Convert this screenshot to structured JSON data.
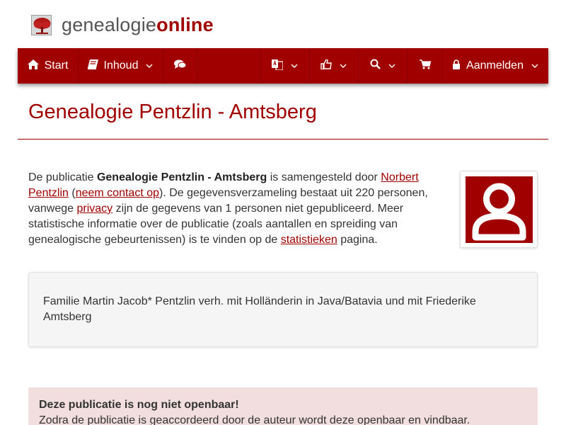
{
  "logo": {
    "text_part1": "genealogie",
    "text_part2": "online",
    "icon": "tree-icon"
  },
  "nav": {
    "start_label": "Start",
    "start_icon": "home-icon",
    "inhoud_label": "Inhoud",
    "inhoud_icon": "book-icon",
    "forum_icon": "comments-icon",
    "language_icon": "translate-icon",
    "like_icon": "thumbs-up-icon",
    "search_icon": "search-icon",
    "cart_icon": "cart-icon",
    "login_label": "Aanmelden",
    "login_icon": "lock-icon"
  },
  "page": {
    "title": "Genealogie Pentzlin - Amtsberg"
  },
  "intro": {
    "p1": "De publicatie ",
    "pub_name": "Genealogie Pentzlin - Amtsberg",
    "p2": " is samengesteld door ",
    "author": "Norbert Pentzlin",
    "p3": " (",
    "contact": "neem contact op",
    "p4": "). De gegevensverzameling bestaat uit 220 personen, vanwege ",
    "privacy": "privacy",
    "p5": " zijn de gegevens van 1 personen niet gepubliceerd. Meer statistische informatie over de publicatie (zoals aantallen en spreiding van genealogische gebeurtenissen) is te vinden op de ",
    "stats": "statistieken",
    "p6": " pagina."
  },
  "description": "Familie Martin Jacob* Pentzlin verh. mit Holländerin in Java/Batavia und mit Friederike Amtsberg",
  "alert": {
    "title": "Deze publicatie is nog niet openbaar!",
    "text": "Zodra de publicatie is geaccordeerd door de auteur wordt deze openbaar en vindbaar."
  },
  "colors": {
    "brand": "#a00000",
    "alert_bg": "#f2dede"
  }
}
